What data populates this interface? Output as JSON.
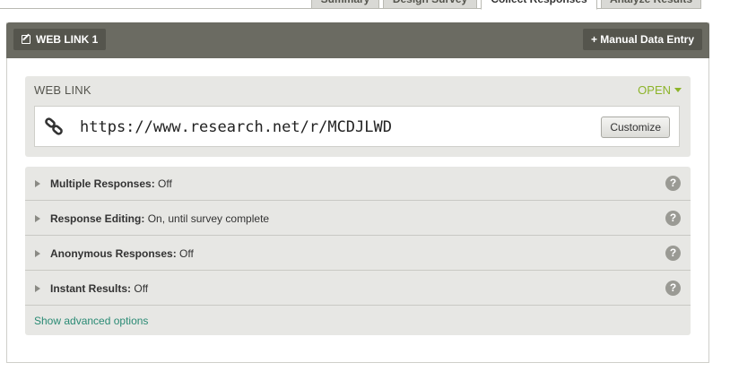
{
  "tabs": [
    {
      "label": "Summary",
      "active": false
    },
    {
      "label": "Design Survey",
      "active": false
    },
    {
      "label": "Collect Responses",
      "active": true
    },
    {
      "label": "Analyze Results",
      "active": false
    }
  ],
  "header": {
    "title": "WEB LINK 1",
    "manual_entry_label": "+ Manual Data Entry"
  },
  "weblink": {
    "section_title": "WEB LINK",
    "status": "OPEN",
    "url": "https://www.research.net/r/MCDJLWD",
    "customize_label": "Customize"
  },
  "options": [
    {
      "label": "Multiple Responses:",
      "value": "Off"
    },
    {
      "label": "Response Editing:",
      "value": "On, until survey complete"
    },
    {
      "label": "Anonymous Responses:",
      "value": "Off"
    },
    {
      "label": "Instant Results:",
      "value": "Off"
    }
  ],
  "help_glyph": "?",
  "advanced_label": "Show advanced options",
  "colors": {
    "header_bg": "#6b6b62",
    "button_bg": "#55554d",
    "status_open": "#8db42a",
    "link": "#2a8a74"
  }
}
